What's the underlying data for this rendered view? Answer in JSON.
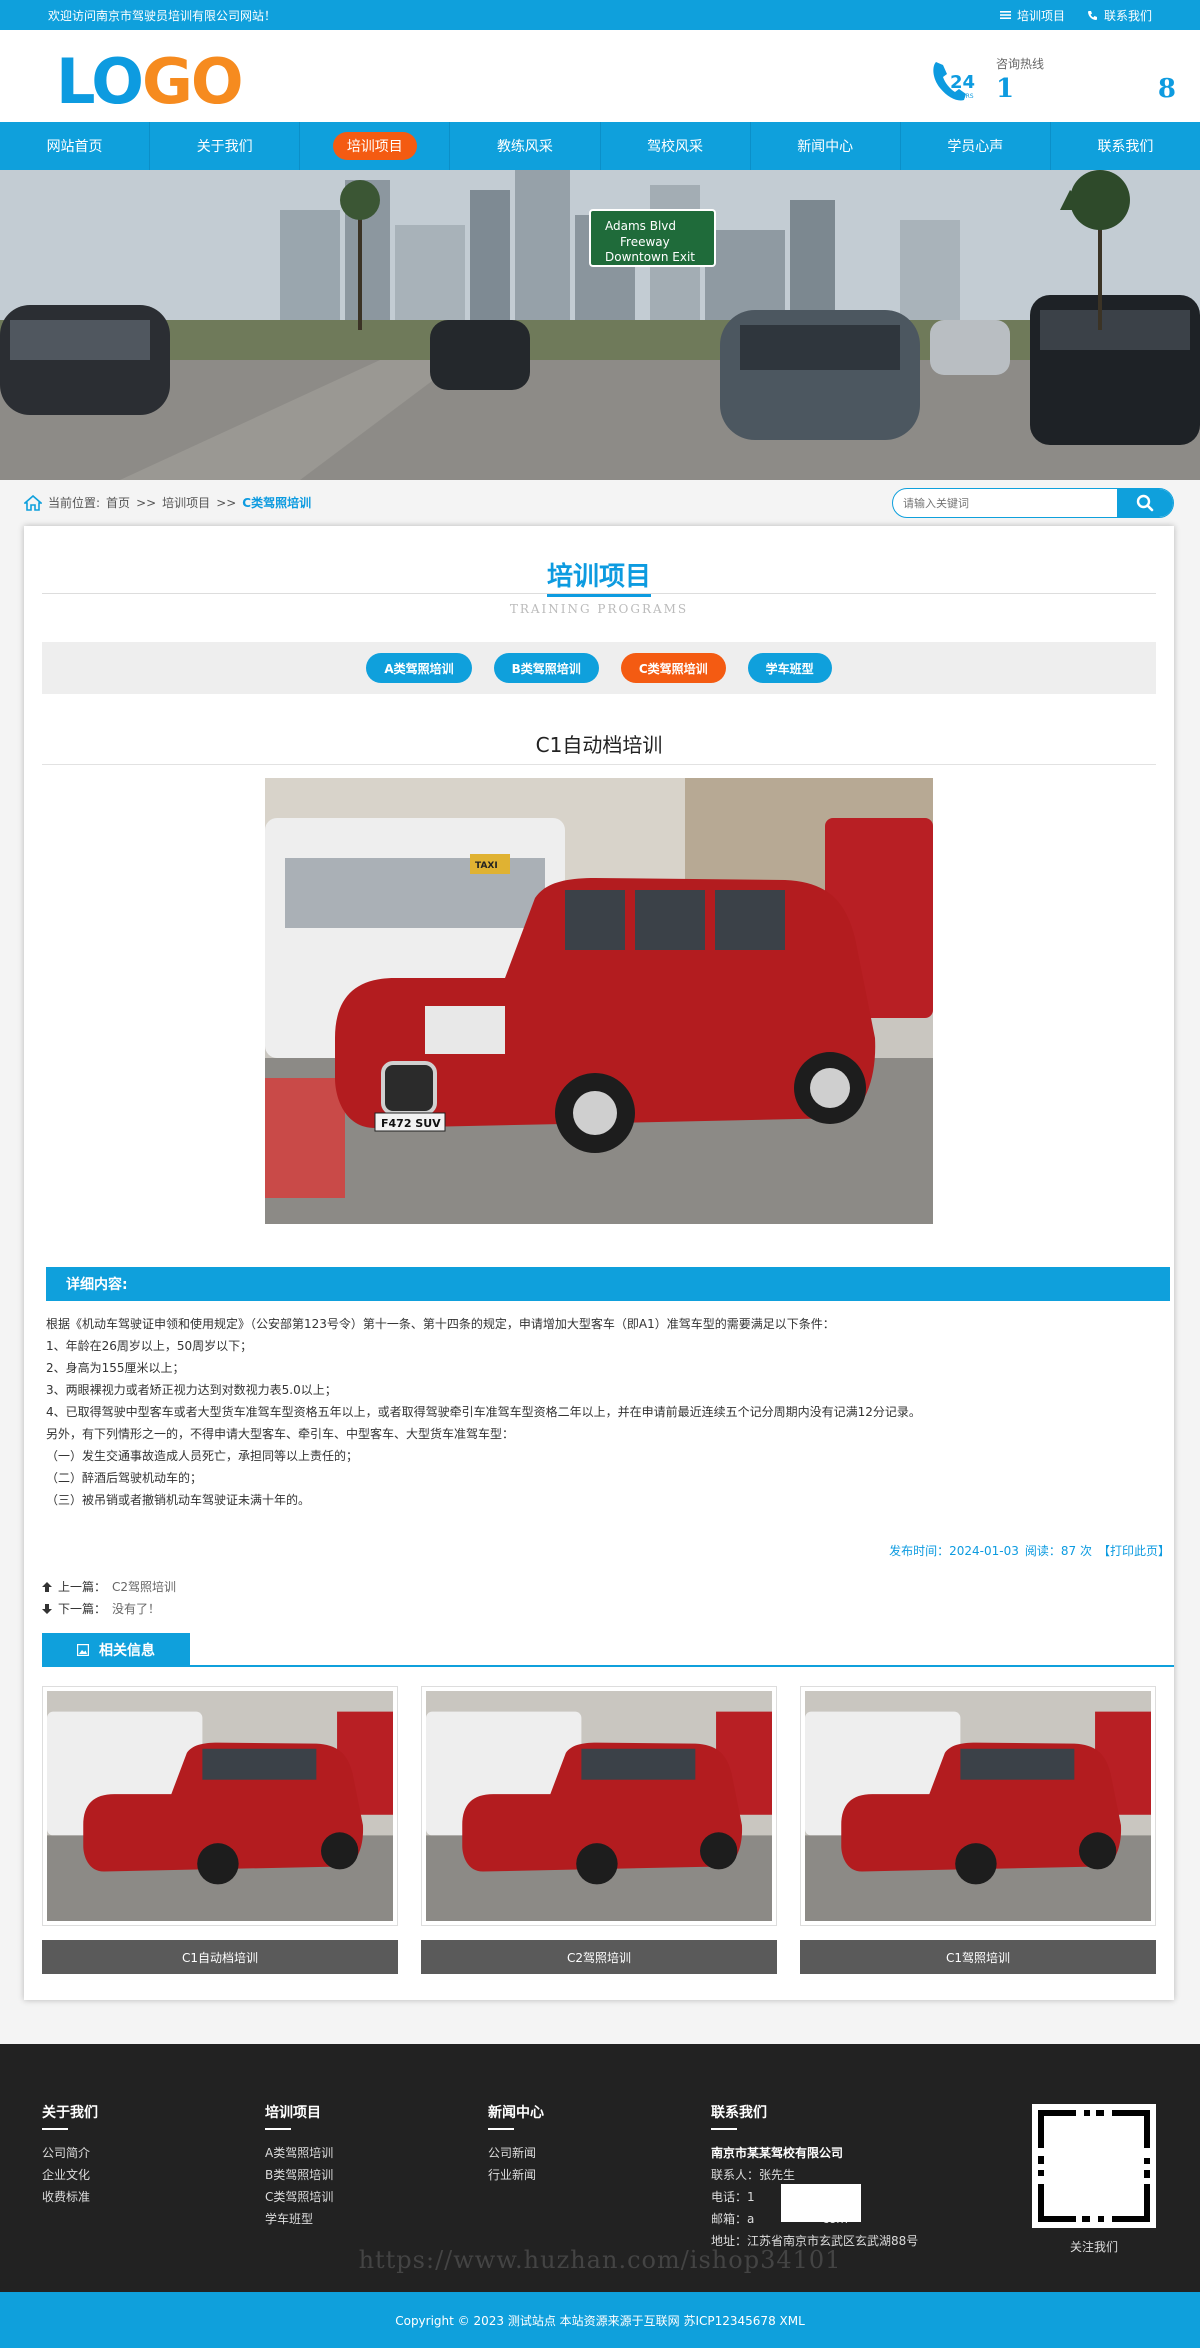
{
  "topbar": {
    "welcome": "欢迎访问南京市驾驶员培训有限公司网站！",
    "link1": "培训项目",
    "link2": "联系我们"
  },
  "header": {
    "logo_part1": "LO",
    "logo_part2": "GO",
    "hotline_label": "咨询热线",
    "hotline_left": "1",
    "hotline_right": "8"
  },
  "nav": [
    {
      "label": "网站首页"
    },
    {
      "label": "关于我们"
    },
    {
      "label": "培训项目",
      "active": true
    },
    {
      "label": "教练风采"
    },
    {
      "label": "驾校风采"
    },
    {
      "label": "新闻中心"
    },
    {
      "label": "学员心声"
    },
    {
      "label": "联系我们"
    }
  ],
  "banner": {
    "sign1": "Adams Blvd",
    "sign2": "Freeway",
    "sign3": "Downtown Exit"
  },
  "breadcrumb": {
    "prefix": "当前位置:",
    "home": "首页",
    "sep": ">>",
    "level1": "培训项目",
    "current": "C类驾照培训"
  },
  "search": {
    "placeholder": "请输入关键词"
  },
  "section": {
    "title": "培训项目",
    "subtitle": "TRAINING PROGRAMS"
  },
  "tabs": [
    {
      "label": "A类驾照培训"
    },
    {
      "label": "B类驾照培训"
    },
    {
      "label": "C类驾照培训",
      "active": true
    },
    {
      "label": "学车班型"
    }
  ],
  "article": {
    "title": "C1自动档培训",
    "detail_heading": "详细内容:",
    "paragraphs": [
      "根据《机动车驾驶证申领和使用规定》（公安部第123号令）第十一条、第十四条的规定，申请增加大型客车（即A1）准驾车型的需要满足以下条件：",
      "1、年龄在26周岁以上，50周岁以下；",
      "2、身高为155厘米以上；",
      "3、两眼裸视力或者矫正视力达到对数视力表5.0以上；",
      "4、已取得驾驶中型客车或者大型货车准驾车型资格五年以上，或者取得驾驶牵引车准驾车型资格二年以上，并在申请前最近连续五个记分周期内没有记满12分记录。",
      "另外，有下列情形之一的，不得申请大型客车、牵引车、中型客车、大型货车准驾车型：",
      "（一）发生交通事故造成人员死亡，承担同等以上责任的；",
      "（二）醉酒后驾驶机动车的；",
      "（三）被吊销或者撤销机动车驾驶证未满十年的。"
    ],
    "publish": "发布时间：2024-01-03",
    "reads": "阅读：87 次",
    "print": "【打印此页】",
    "prev_label": "上一篇：",
    "prev_title": "C2驾照培训",
    "next_label": "下一篇：",
    "next_title": "没有了！",
    "plate": "F472 SUV",
    "taxi_sign": "TAXI"
  },
  "related": {
    "heading": "相关信息",
    "items": [
      {
        "caption": "C1自动档培训"
      },
      {
        "caption": "C2驾照培训"
      },
      {
        "caption": "C1驾照培训"
      }
    ]
  },
  "footer": {
    "col1": {
      "title": "关于我们",
      "items": [
        "公司简介",
        "企业文化",
        "收费标准"
      ]
    },
    "col2": {
      "title": "培训项目",
      "items": [
        "A类驾照培训",
        "B类驾照培训",
        "C类驾照培训",
        "学车班型"
      ]
    },
    "col3": {
      "title": "新闻中心",
      "items": [
        "公司新闻",
        "行业新闻"
      ]
    },
    "col4": {
      "title": "联系我们",
      "company": "南京市某某驾校有限公司",
      "contact": "联系人：张先生",
      "phone": "电话：1",
      "email": "邮箱：a",
      "email_tail": "com",
      "address": "地址：江苏省南京市玄武区玄武湖88号"
    },
    "qr_label": "关注我们",
    "watermark": "https://www.huzhan.com/ishop34101",
    "copyright": "Copyright © 2023 测试站点 本站资源来源于互联网 苏ICP12345678 XML"
  },
  "colors": {
    "brand": "#0fa0dc",
    "accent": "#f45b12",
    "footer": "#222222"
  }
}
